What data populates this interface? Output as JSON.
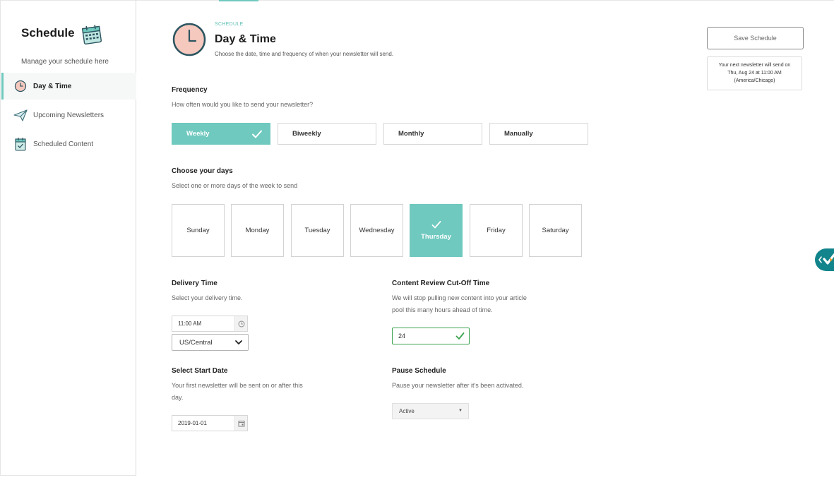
{
  "sidebar": {
    "title": "Schedule",
    "subtitle": "Manage your schedule here",
    "items": [
      {
        "label": "Day & Time",
        "active": true
      },
      {
        "label": "Upcoming Newsletters",
        "active": false
      },
      {
        "label": "Scheduled Content",
        "active": false
      }
    ]
  },
  "header": {
    "kicker": "SCHEDULE",
    "title": "Day & Time",
    "description": "Choose the date, time and frequency of when your newsletter will send."
  },
  "actions": {
    "save_label": "Save Schedule",
    "next_send_line1": "Your next newsletter will send on",
    "next_send_line2": "Thu, Aug 24 at 11:00 AM",
    "next_send_line3": "(America/Chicago)"
  },
  "frequency": {
    "label": "Frequency",
    "hint": "How often would you like to send your newsletter?",
    "options": [
      "Weekly",
      "Biweekly",
      "Monthly",
      "Manually"
    ],
    "selected": "Weekly"
  },
  "days": {
    "label": "Choose your days",
    "hint": "Select one or more days of the week to send",
    "options": [
      "Sunday",
      "Monday",
      "Tuesday",
      "Wednesday",
      "Thursday",
      "Friday",
      "Saturday"
    ],
    "selected": [
      "Thursday"
    ]
  },
  "delivery": {
    "label": "Delivery Time",
    "hint": "Select your delivery time.",
    "time_value": "11:00 AM",
    "timezone_value": "US/Central"
  },
  "cutoff": {
    "label": "Content Review Cut-Off Time",
    "hint_line1": "We will stop pulling new content into your article",
    "hint_line2": "pool this many hours ahead of time.",
    "value": "24"
  },
  "start_date": {
    "label": "Select Start Date",
    "hint_line1": "Your first newsletter will be sent on or after this",
    "hint_line2": "day.",
    "value": "2019-01-01"
  },
  "pause": {
    "label": "Pause Schedule",
    "hint": "Pause your newsletter after it's been activated.",
    "value": "Active"
  },
  "colors": {
    "accent": "#70c9bf",
    "success": "#3aa24f",
    "widget": "#12848b"
  },
  "icons": {
    "sidebar_title": "calendar-icon",
    "header": "clock-icon",
    "items": [
      "clock-icon",
      "paper-plane-icon",
      "calendar-check-icon"
    ]
  }
}
